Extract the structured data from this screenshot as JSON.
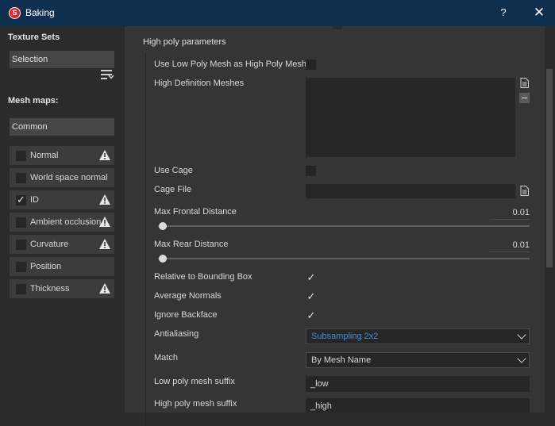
{
  "window": {
    "title": "Baking",
    "help_label": "?",
    "close_label": "✕"
  },
  "left": {
    "texture_sets_title": "Texture Sets",
    "selection_label": "Selection",
    "mesh_maps_title": "Mesh maps:",
    "common_label": "Common",
    "maps": [
      {
        "label": "Normal",
        "checked": false,
        "warning": true
      },
      {
        "label": "World space normal",
        "checked": false,
        "warning": false
      },
      {
        "label": "ID",
        "checked": true,
        "warning": true
      },
      {
        "label": "Ambient occlusion",
        "checked": false,
        "warning": true
      },
      {
        "label": "Curvature",
        "checked": false,
        "warning": true
      },
      {
        "label": "Position",
        "checked": false,
        "warning": false
      },
      {
        "label": "Thickness",
        "checked": false,
        "warning": true
      }
    ]
  },
  "params": {
    "section_title": "High poly parameters",
    "use_low_poly_label": "Use Low Poly Mesh as High Poly Mesh",
    "use_low_poly_checked": false,
    "high_def_meshes_label": "High Definition Meshes",
    "use_cage_label": "Use Cage",
    "use_cage_checked": false,
    "cage_file_label": "Cage File",
    "cage_file_value": "",
    "max_frontal_label": "Max Frontal Distance",
    "max_frontal_value": "0.01",
    "max_frontal_fraction": 0.01,
    "max_rear_label": "Max Rear Distance",
    "max_rear_value": "0.01",
    "max_rear_fraction": 0.01,
    "relative_bbox_label": "Relative to Bounding Box",
    "relative_bbox_checked": true,
    "average_normals_label": "Average Normals",
    "average_normals_checked": true,
    "ignore_backface_label": "Ignore Backface",
    "ignore_backface_checked": true,
    "antialiasing_label": "Antialiasing",
    "antialiasing_value": "Subsampling 2x2",
    "match_label": "Match",
    "match_value": "By Mesh Name",
    "low_suffix_label": "Low poly mesh suffix",
    "low_suffix_value": "_low",
    "high_suffix_label": "High poly mesh suffix",
    "high_suffix_value": "_high"
  },
  "colors": {
    "titlebar": "#0f2f4f",
    "accent_text": "#3d8fe0",
    "app_icon": "#d8262a",
    "warning_fill": "#e6e6e6"
  }
}
